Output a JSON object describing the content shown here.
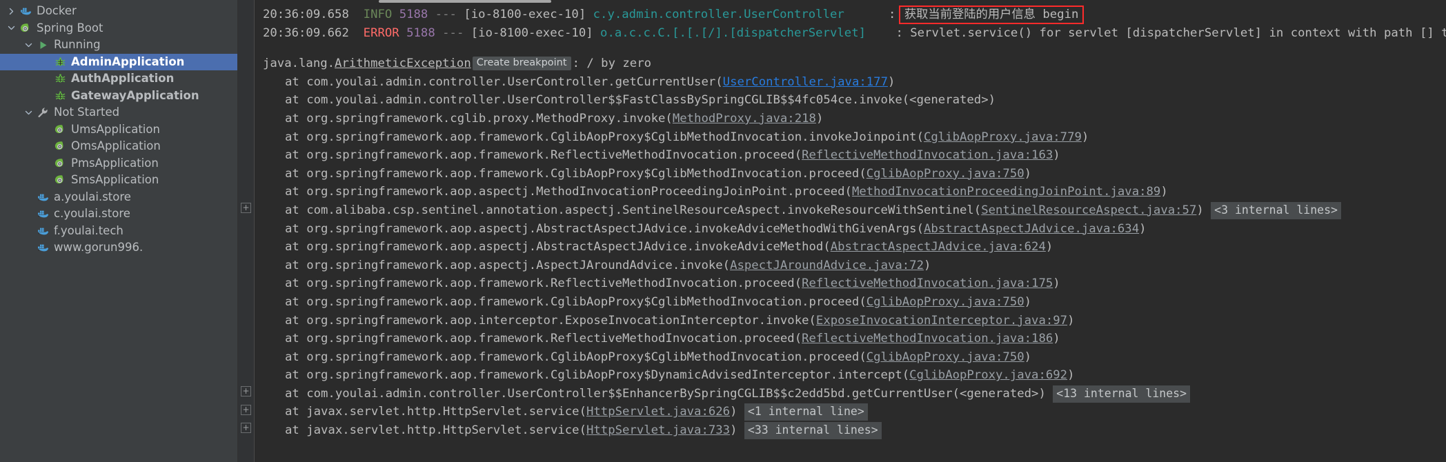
{
  "sidebar": {
    "items": [
      {
        "label": "Docker",
        "icon": "docker-icon",
        "arrow": "chevron-right",
        "indent": 0,
        "bold": false,
        "selected": false
      },
      {
        "label": "Spring Boot",
        "icon": "spring-boot-icon",
        "arrow": "chevron-down",
        "indent": 0,
        "bold": false,
        "selected": false
      },
      {
        "label": "Running",
        "icon": "run-icon",
        "arrow": "chevron-down",
        "indent": 1,
        "bold": false,
        "selected": false
      },
      {
        "label": "AdminApplication",
        "icon": "bug-icon",
        "arrow": "none",
        "indent": 2,
        "bold": true,
        "selected": true
      },
      {
        "label": "AuthApplication",
        "icon": "bug-icon",
        "arrow": "none",
        "indent": 2,
        "bold": true,
        "selected": false
      },
      {
        "label": "GatewayApplication",
        "icon": "bug-icon",
        "arrow": "none",
        "indent": 2,
        "bold": true,
        "selected": false
      },
      {
        "label": "Not Started",
        "icon": "wrench-icon",
        "arrow": "chevron-down",
        "indent": 1,
        "bold": false,
        "selected": false
      },
      {
        "label": "UmsApplication",
        "icon": "spring-boot-icon",
        "arrow": "none",
        "indent": 2,
        "bold": false,
        "selected": false
      },
      {
        "label": "OmsApplication",
        "icon": "spring-boot-icon",
        "arrow": "none",
        "indent": 2,
        "bold": false,
        "selected": false
      },
      {
        "label": "PmsApplication",
        "icon": "spring-boot-icon",
        "arrow": "none",
        "indent": 2,
        "bold": false,
        "selected": false
      },
      {
        "label": "SmsApplication",
        "icon": "spring-boot-icon",
        "arrow": "none",
        "indent": 2,
        "bold": false,
        "selected": false
      },
      {
        "label": "a.youlai.store",
        "icon": "docker-icon",
        "arrow": "none",
        "indent": 1,
        "bold": false,
        "selected": false
      },
      {
        "label": "c.youlai.store",
        "icon": "docker-icon",
        "arrow": "none",
        "indent": 1,
        "bold": false,
        "selected": false
      },
      {
        "label": "f.youlai.tech",
        "icon": "docker-icon",
        "arrow": "none",
        "indent": 1,
        "bold": false,
        "selected": false
      },
      {
        "label": "www.gorun996.",
        "icon": "docker-icon",
        "arrow": "none",
        "indent": 1,
        "bold": false,
        "selected": false
      }
    ]
  },
  "colors": {
    "selection": "#4b6eaf",
    "sidebar_bg": "#3c3f41",
    "console_bg": "#2b2b2b",
    "info": "#6a8759",
    "error": "#ff6b68",
    "pid": "#9876aa",
    "logger": "#299999",
    "link": "#287bde",
    "highlight_border": "#ff2b2b"
  },
  "console": {
    "log_lines": [
      {
        "time": "20:36:09.658",
        "level": "INFO",
        "pid": "5188",
        "sep": "---",
        "thread": "[io-8100-exec-10]",
        "logger": "c.y.admin.controller.UserController",
        "colon": ":",
        "message": "获取当前登陆的用户信息 begin",
        "highlighted": true
      },
      {
        "time": "20:36:09.662",
        "level": "ERROR",
        "pid": "5188",
        "sep": "---",
        "thread": "[io-8100-exec-10]",
        "logger": "o.a.c.c.C.[.[.[/].[dispatcherServlet]",
        "colon": ":",
        "message": "Servlet.service() for servlet [dispatcherServlet] in context with path [] threw excep",
        "highlighted": false
      }
    ],
    "exception": {
      "package": "java.lang.",
      "name": "ArithmeticException",
      "breakpoint_chip": "Create breakpoint",
      "colon": ":",
      "detail": "/ by zero"
    },
    "stack": [
      {
        "fold": false,
        "at": "at ",
        "frame": "com.youlai.admin.controller.UserController.getCurrentUser(",
        "link": "UserController.java:177",
        "link_style": "blue",
        "tail": ")",
        "chip": ""
      },
      {
        "fold": false,
        "at": "at ",
        "frame": "com.youlai.admin.controller.UserController$$FastClassBySpringCGLIB$$4fc054ce.invoke(<generated>)",
        "link": "",
        "link_style": "",
        "tail": "",
        "chip": ""
      },
      {
        "fold": false,
        "at": "at ",
        "frame": "org.springframework.cglib.proxy.MethodProxy.invoke(",
        "link": "MethodProxy.java:218",
        "link_style": "dim",
        "tail": ")",
        "chip": ""
      },
      {
        "fold": false,
        "at": "at ",
        "frame": "org.springframework.aop.framework.CglibAopProxy$CglibMethodInvocation.invokeJoinpoint(",
        "link": "CglibAopProxy.java:779",
        "link_style": "dim",
        "tail": ")",
        "chip": ""
      },
      {
        "fold": false,
        "at": "at ",
        "frame": "org.springframework.aop.framework.ReflectiveMethodInvocation.proceed(",
        "link": "ReflectiveMethodInvocation.java:163",
        "link_style": "dim",
        "tail": ")",
        "chip": ""
      },
      {
        "fold": false,
        "at": "at ",
        "frame": "org.springframework.aop.framework.CglibAopProxy$CglibMethodInvocation.proceed(",
        "link": "CglibAopProxy.java:750",
        "link_style": "dim",
        "tail": ")",
        "chip": ""
      },
      {
        "fold": false,
        "at": "at ",
        "frame": "org.springframework.aop.aspectj.MethodInvocationProceedingJoinPoint.proceed(",
        "link": "MethodInvocationProceedingJoinPoint.java:89",
        "link_style": "dim",
        "tail": ")",
        "chip": ""
      },
      {
        "fold": true,
        "at": "at ",
        "frame": "com.alibaba.csp.sentinel.annotation.aspectj.SentinelResourceAspect.invokeResourceWithSentinel(",
        "link": "SentinelResourceAspect.java:57",
        "link_style": "dim",
        "tail": ")",
        "chip": "<3 internal lines>"
      },
      {
        "fold": false,
        "at": "at ",
        "frame": "org.springframework.aop.aspectj.AbstractAspectJAdvice.invokeAdviceMethodWithGivenArgs(",
        "link": "AbstractAspectJAdvice.java:634",
        "link_style": "dim",
        "tail": ")",
        "chip": ""
      },
      {
        "fold": false,
        "at": "at ",
        "frame": "org.springframework.aop.aspectj.AbstractAspectJAdvice.invokeAdviceMethod(",
        "link": "AbstractAspectJAdvice.java:624",
        "link_style": "dim",
        "tail": ")",
        "chip": ""
      },
      {
        "fold": false,
        "at": "at ",
        "frame": "org.springframework.aop.aspectj.AspectJAroundAdvice.invoke(",
        "link": "AspectJAroundAdvice.java:72",
        "link_style": "dim",
        "tail": ")",
        "chip": ""
      },
      {
        "fold": false,
        "at": "at ",
        "frame": "org.springframework.aop.framework.ReflectiveMethodInvocation.proceed(",
        "link": "ReflectiveMethodInvocation.java:175",
        "link_style": "dim",
        "tail": ")",
        "chip": ""
      },
      {
        "fold": false,
        "at": "at ",
        "frame": "org.springframework.aop.framework.CglibAopProxy$CglibMethodInvocation.proceed(",
        "link": "CglibAopProxy.java:750",
        "link_style": "dim",
        "tail": ")",
        "chip": ""
      },
      {
        "fold": false,
        "at": "at ",
        "frame": "org.springframework.aop.interceptor.ExposeInvocationInterceptor.invoke(",
        "link": "ExposeInvocationInterceptor.java:97",
        "link_style": "dim",
        "tail": ")",
        "chip": ""
      },
      {
        "fold": false,
        "at": "at ",
        "frame": "org.springframework.aop.framework.ReflectiveMethodInvocation.proceed(",
        "link": "ReflectiveMethodInvocation.java:186",
        "link_style": "dim",
        "tail": ")",
        "chip": ""
      },
      {
        "fold": false,
        "at": "at ",
        "frame": "org.springframework.aop.framework.CglibAopProxy$CglibMethodInvocation.proceed(",
        "link": "CglibAopProxy.java:750",
        "link_style": "dim",
        "tail": ")",
        "chip": ""
      },
      {
        "fold": false,
        "at": "at ",
        "frame": "org.springframework.aop.framework.CglibAopProxy$DynamicAdvisedInterceptor.intercept(",
        "link": "CglibAopProxy.java:692",
        "link_style": "dim",
        "tail": ")",
        "chip": ""
      },
      {
        "fold": true,
        "at": "at ",
        "frame": "com.youlai.admin.controller.UserController$$EnhancerBySpringCGLIB$$c2edd5bd.getCurrentUser(<generated>)",
        "link": "",
        "link_style": "",
        "tail": "",
        "chip": "<13 internal lines>"
      },
      {
        "fold": true,
        "at": "at ",
        "frame": "javax.servlet.http.HttpServlet.service(",
        "link": "HttpServlet.java:626",
        "link_style": "dim",
        "tail": ")",
        "chip": "<1 internal line>"
      },
      {
        "fold": true,
        "at": "at ",
        "frame": "javax.servlet.http.HttpServlet.service(",
        "link": "HttpServlet.java:733",
        "link_style": "dim",
        "tail": ")",
        "chip": "<33 internal lines>"
      }
    ]
  }
}
